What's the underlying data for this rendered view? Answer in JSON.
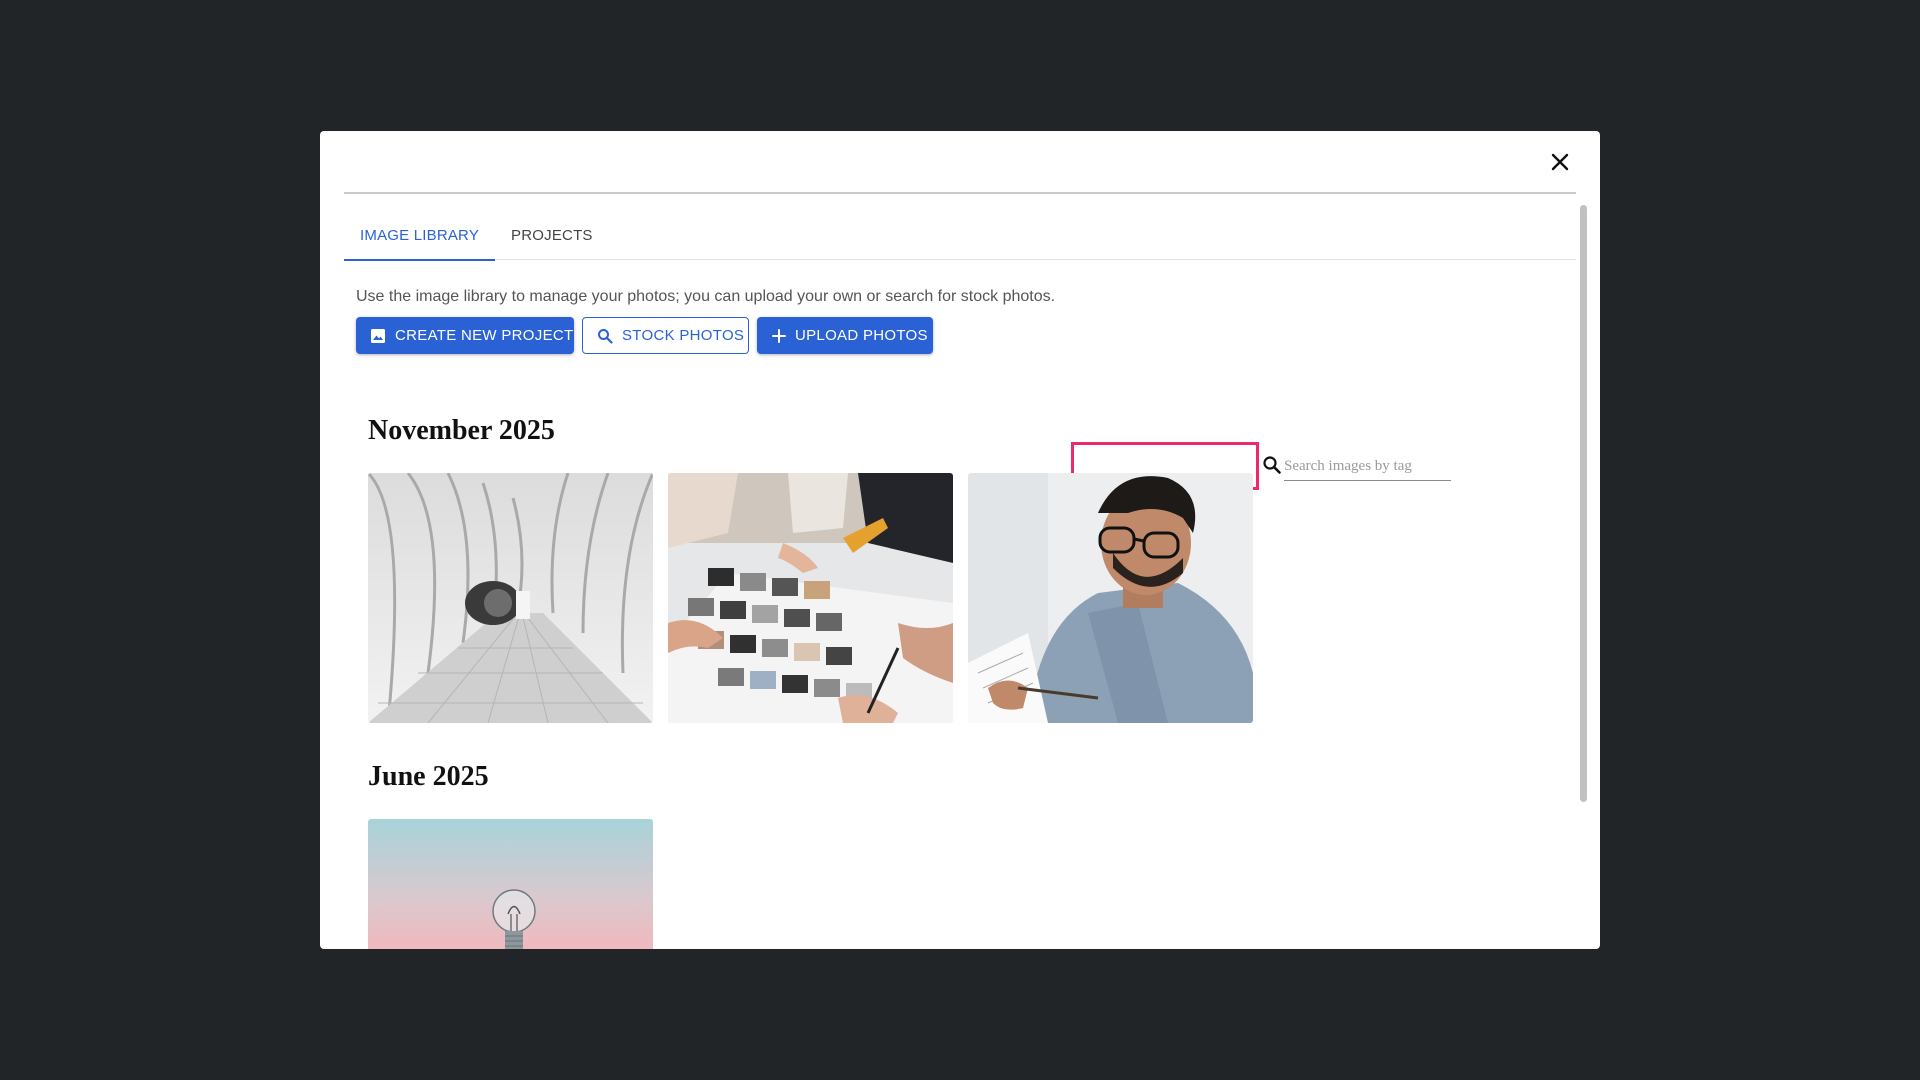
{
  "dialog": {
    "close_icon": "close-icon"
  },
  "tabs": [
    {
      "label": "IMAGE LIBRARY",
      "active": true
    },
    {
      "label": "PROJECTS",
      "active": false
    }
  ],
  "intro_text": "Use the image library to manage your photos; you can upload your own or search for stock photos.",
  "toolbar": {
    "create_label": "CREATE NEW PROJECT",
    "create_icon": "image-icon",
    "stock_label": "STOCK PHOTOS",
    "stock_icon": "search-icon",
    "upload_label": "UPLOAD PHOTOS",
    "upload_icon": "plus-icon",
    "search_placeholder": "Search images by tag",
    "search_value": ""
  },
  "colors": {
    "accent": "#2a62d6",
    "highlight": "#ea2a6a",
    "overlay": "#222528"
  },
  "gallery": [
    {
      "month": "November 2025",
      "images": [
        {
          "subject": "white-arched-corridor"
        },
        {
          "subject": "team-reviewing-photo-prints"
        },
        {
          "subject": "man-with-glasses-sketching"
        }
      ]
    },
    {
      "month": "June 2025",
      "images": [
        {
          "subject": "light-bulb-against-pastel-sky"
        }
      ]
    }
  ]
}
